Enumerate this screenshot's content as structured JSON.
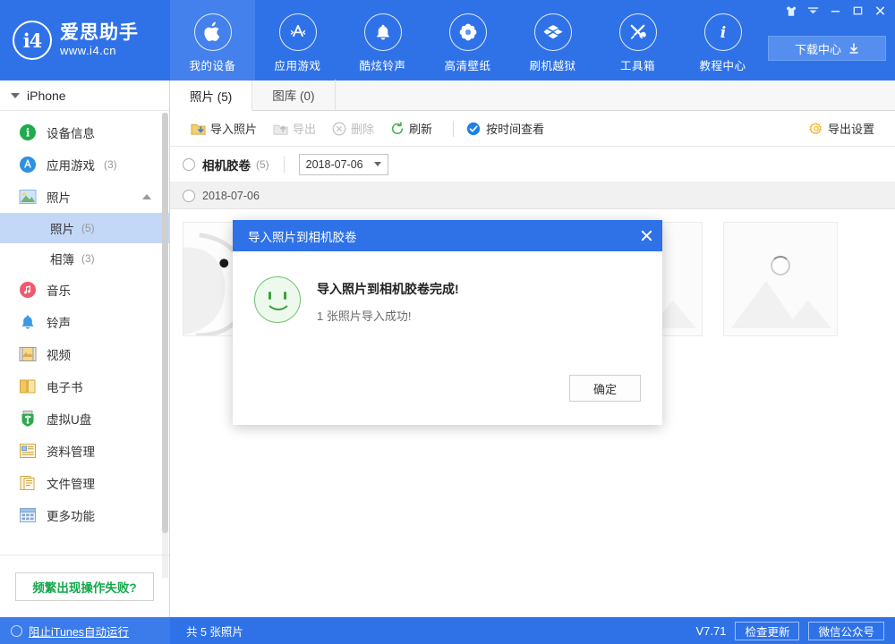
{
  "brand": {
    "mark": "i4",
    "name": "爱思助手",
    "url": "www.i4.cn"
  },
  "topnav": {
    "items": [
      {
        "label": "我的设备",
        "icon": "apple-icon",
        "active": true
      },
      {
        "label": "应用游戏",
        "icon": "appstore-icon",
        "active": false
      },
      {
        "label": "酷炫铃声",
        "icon": "bell-icon",
        "active": false
      },
      {
        "label": "高清壁纸",
        "icon": "flower-icon",
        "active": false
      },
      {
        "label": "刷机越狱",
        "icon": "box-icon",
        "active": false
      },
      {
        "label": "工具箱",
        "icon": "tools-icon",
        "active": false
      },
      {
        "label": "教程中心",
        "icon": "info-icon",
        "active": false
      }
    ],
    "download_center": "下载中心"
  },
  "window_controls": {
    "skin": "tshirt-icon",
    "menu": "chevron-down-icon",
    "minimize": "minimize-icon",
    "maximize": "maximize-icon",
    "close": "close-icon"
  },
  "sidebar": {
    "device": "iPhone",
    "items": [
      {
        "label": "设备信息",
        "count": "",
        "icon": "info-badge-icon"
      },
      {
        "label": "应用游戏",
        "count": "(3)",
        "icon": "appstore-badge-icon"
      },
      {
        "label": "照片",
        "count": "",
        "icon": "photos-icon",
        "expanded": true
      },
      {
        "label": "音乐",
        "count": "",
        "icon": "music-icon"
      },
      {
        "label": "铃声",
        "count": "",
        "icon": "ringtone-icon"
      },
      {
        "label": "视频",
        "count": "",
        "icon": "video-icon"
      },
      {
        "label": "电子书",
        "count": "",
        "icon": "book-icon"
      },
      {
        "label": "虚拟U盘",
        "count": "",
        "icon": "usb-icon"
      },
      {
        "label": "资料管理",
        "count": "",
        "icon": "data-icon"
      },
      {
        "label": "文件管理",
        "count": "",
        "icon": "file-icon"
      },
      {
        "label": "更多功能",
        "count": "",
        "icon": "more-icon"
      }
    ],
    "photo_subitems": [
      {
        "label": "照片",
        "count": "(5)",
        "selected": true
      },
      {
        "label": "相簿",
        "count": "(3)",
        "selected": false
      }
    ],
    "help_button": "频繁出现操作失败?"
  },
  "main": {
    "tabs": [
      {
        "label": "照片 (5)",
        "active": true
      },
      {
        "label": "图库 (0)",
        "active": false
      }
    ],
    "toolbar": {
      "import": "导入照片",
      "export": "导出",
      "delete": "删除",
      "refresh": "刷新",
      "view_by_time": "按时间查看",
      "export_settings": "导出设置"
    },
    "filter": {
      "camera_roll": "相机胶卷",
      "camera_roll_count": "(5)",
      "date_value": "2018-07-06"
    },
    "date_group": "2018-07-06",
    "thumbnails": [
      {
        "name": "photo-earbuds",
        "kind": "photo"
      },
      {
        "name": "photo-loading-1",
        "kind": "placeholder"
      },
      {
        "name": "photo-loading-2",
        "kind": "placeholder"
      },
      {
        "name": "photo-loading-3",
        "kind": "placeholder"
      },
      {
        "name": "photo-loading-4",
        "kind": "placeholder"
      }
    ]
  },
  "dialog": {
    "title": "导入照片到相机胶卷",
    "message": "导入照片到相机胶卷完成!",
    "detail": "1 张照片导入成功!",
    "ok": "确定",
    "close_icon": "close-icon",
    "status_icon": "smiley-success-icon"
  },
  "statusbar": {
    "itunes_toggle": "阻止iTunes自动运行",
    "photo_count": "共 5 张照片",
    "version": "V7.71",
    "check_update": "检查更新",
    "wechat": "微信公众号"
  },
  "colors": {
    "brand_blue": "#2f72e8",
    "nav_active": "#4581ec",
    "selected_row": "#c3d8f7",
    "success_green": "#3e9e3e",
    "help_green": "#13a84b"
  }
}
